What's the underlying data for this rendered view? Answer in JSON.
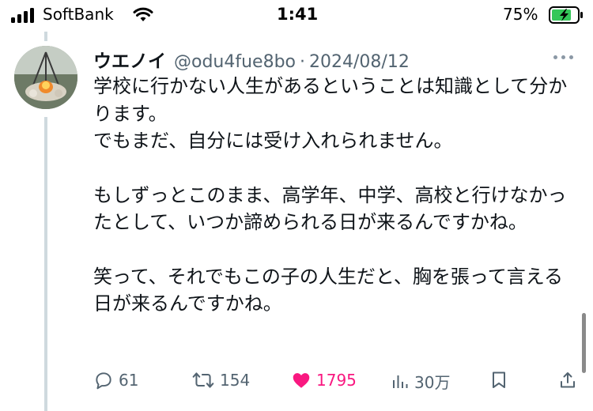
{
  "status_bar": {
    "carrier": "SoftBank",
    "time": "1:41",
    "battery_percent": "75%",
    "icons": [
      "signal-bars-icon",
      "wifi-icon",
      "battery-charging-icon"
    ]
  },
  "tweet": {
    "display_name": "ウエノイ",
    "handle": "@odu4fue8bo",
    "separator": "·",
    "date": "2024/08/12",
    "paragraphs": [
      "学校に行かない人生があるということは知識として分かります。\nでもまだ、自分には受け入れられません。",
      "もしずっとこのまま、高学年、中学、高校と行けなかったとして、いつか諦められる日が来るんですかね。",
      "笑って、それでもこの子の人生だと、胸を張って言える日が来るんですかね。"
    ],
    "actions": {
      "reply_count": "61",
      "retweet_count": "154",
      "like_count": "1795",
      "view_count": "30万",
      "liked": true
    }
  },
  "colors": {
    "text": "#0f1419",
    "secondary": "#536471",
    "like": "#f91880",
    "thread_line": "#cfd9de"
  }
}
